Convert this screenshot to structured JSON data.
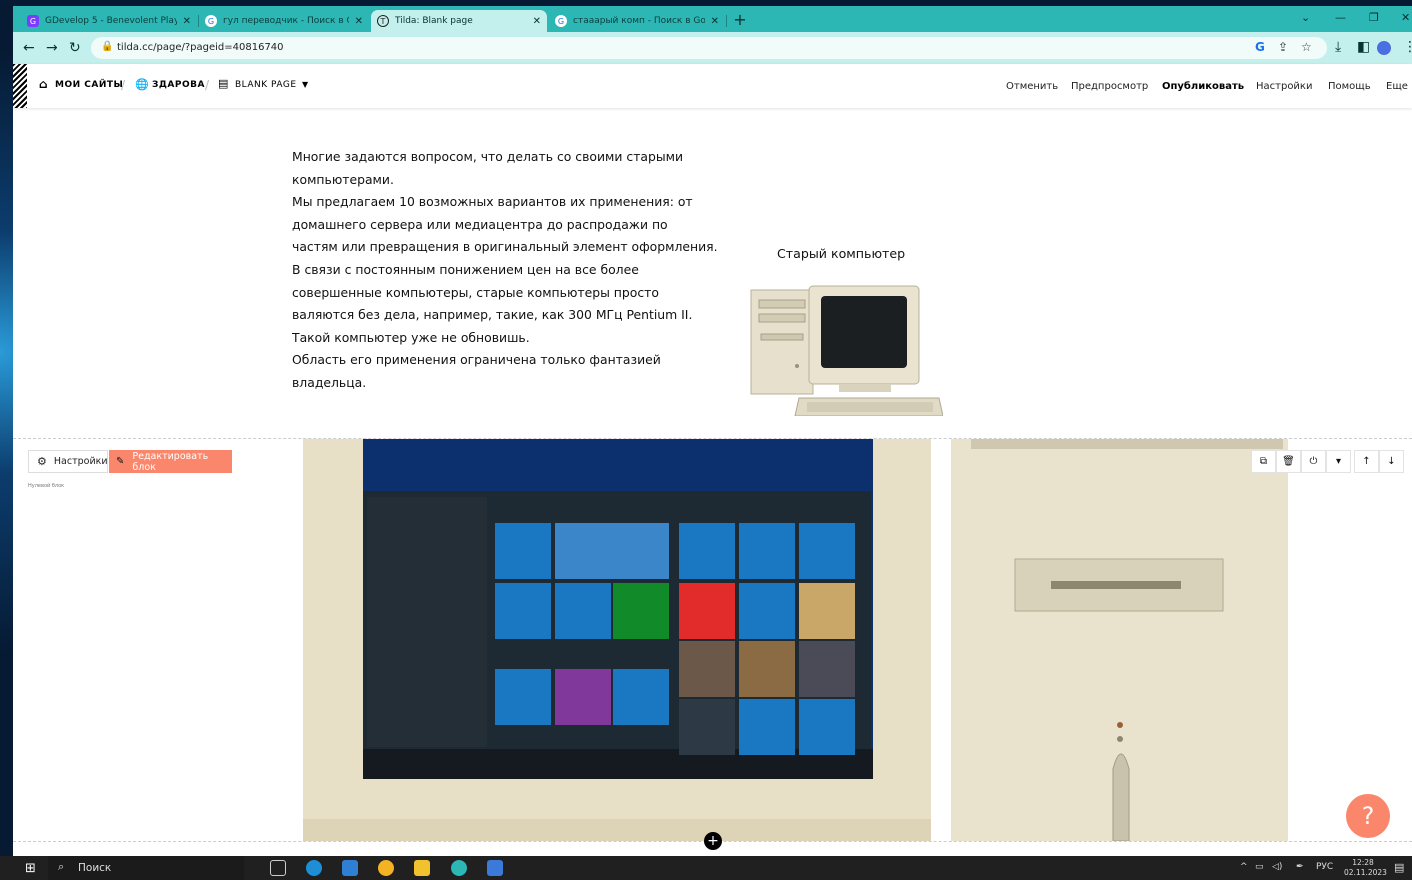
{
  "browser": {
    "tabs": [
      {
        "title": "GDevelop 5 - Benevolent Playg...",
        "favicon": "gdevelop-icon",
        "favicon_color": "#7a3cff",
        "active": false
      },
      {
        "title": "гул переводчик - Поиск в Goo...",
        "favicon": "google-icon",
        "favicon_color": "#1a73e8",
        "active": false
      },
      {
        "title": "Tilda: Blank page",
        "favicon": "tilda-icon",
        "favicon_color": "#222222",
        "active": true
      },
      {
        "title": "стааарый комп - Поиск в Goo...",
        "favicon": "google-icon",
        "favicon_color": "#1a73e8",
        "active": false
      }
    ],
    "url": "tilda.cc/page/?pageid=40816740",
    "tab_strip_color": "#2cb6b4",
    "toolbar_color": "#c3f0ec"
  },
  "tilda": {
    "breadcrumb": {
      "sites": "МОИ САЙТЫ",
      "project": "ЗДАРОВА",
      "page": "BLANK PAGE"
    },
    "menu": {
      "undo": "Отменить",
      "preview": "Предпросмотр",
      "publish": "Опубликовать",
      "settings": "Настройки",
      "help": "Помощь",
      "more": "Еще"
    },
    "text_block": {
      "lines": [
        "Многие задаются вопросом, что делать со своими старыми",
        "компьютерами.",
        "Мы предлагаем 10 возможных вариантов их применения: от",
        "домашнего сервера или медиацентра до распродажи по",
        "частям или превращения в оригинальный элемент оформления.",
        "В связи с постоянным понижением цен на все более",
        "совершенные компьютеры, старые компьютеры просто",
        "валяются без дела, например, такие, как 300 МГц Pentium II.",
        "Такой компьютер уже не обновишь.",
        "Область его применения ограничена только фантазией",
        "владельца."
      ],
      "image_caption": "Старый компьютер"
    },
    "zero_block": {
      "settings_label": "Настройки",
      "edit_label": "Редактировать блок",
      "type_label": "Нулевой блок"
    },
    "accent_color": "#fa876b",
    "help_symbol": "?",
    "add_symbol": "+"
  },
  "taskbar": {
    "search_label": "Поиск",
    "language": "РУС",
    "time": "12:28",
    "date": "02.11.2023"
  }
}
